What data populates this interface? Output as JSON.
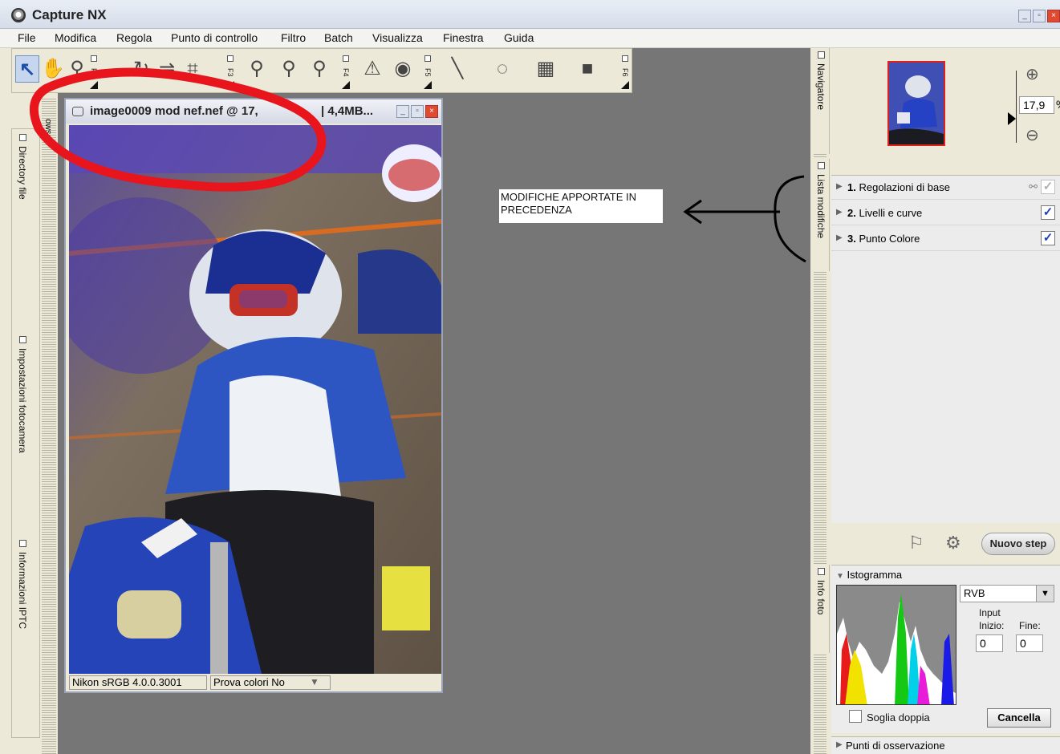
{
  "window": {
    "title": "Capture NX",
    "controls": [
      "_",
      "▫",
      "×"
    ]
  },
  "menu": [
    "File",
    "Modifica",
    "Regola",
    "Punto di controllo",
    "Filtro",
    "Batch",
    "Visualizza",
    "Finestra",
    "Guida"
  ],
  "toolbar": {
    "fkeys": [
      "F3",
      "F4",
      "F5",
      "F6"
    ]
  },
  "left_sidebar": {
    "tabs": [
      "Directory file",
      "Impostazioni fotocamera",
      "Informazioni IPTC"
    ],
    "browser_label": "owser"
  },
  "image_window": {
    "title": "image0009 mod nef.nef @ 17,",
    "size": "| 4,4MB...",
    "status_profile": "Nikon sRGB 4.0.0.3001",
    "status_proof": "Prova colori No"
  },
  "annotation_note": "MODIFICHE APPORTATE IN PRECEDENZA",
  "navigator": {
    "tab": "Navigatore",
    "zoom_value": "17,9",
    "zoom_unit": "%"
  },
  "edit_list": {
    "tab": "Lista modifiche",
    "steps": [
      {
        "num": "1.",
        "label": "Regolazioni di base",
        "checked": true,
        "dim": true
      },
      {
        "num": "2.",
        "label": "Livelli e curve",
        "checked": true,
        "dim": false
      },
      {
        "num": "3.",
        "label": "Punto Colore",
        "checked": true,
        "dim": false
      }
    ],
    "new_step_button": "Nuovo step"
  },
  "histogram": {
    "tab": "Info foto",
    "title": "Istogramma",
    "channel": "RVB",
    "input_label": "Input",
    "start_label": "Inizio:",
    "end_label": "Fine:",
    "start_value": "0",
    "end_value": "0",
    "double_threshold_label": "Soglia doppia",
    "cancel_button": "Cancella"
  },
  "observation_points": "Punti di osservazione",
  "colors": {
    "annotation_red": "#e8151c",
    "check_blue": "#1c3fb5",
    "workspace_gray": "#767676"
  }
}
